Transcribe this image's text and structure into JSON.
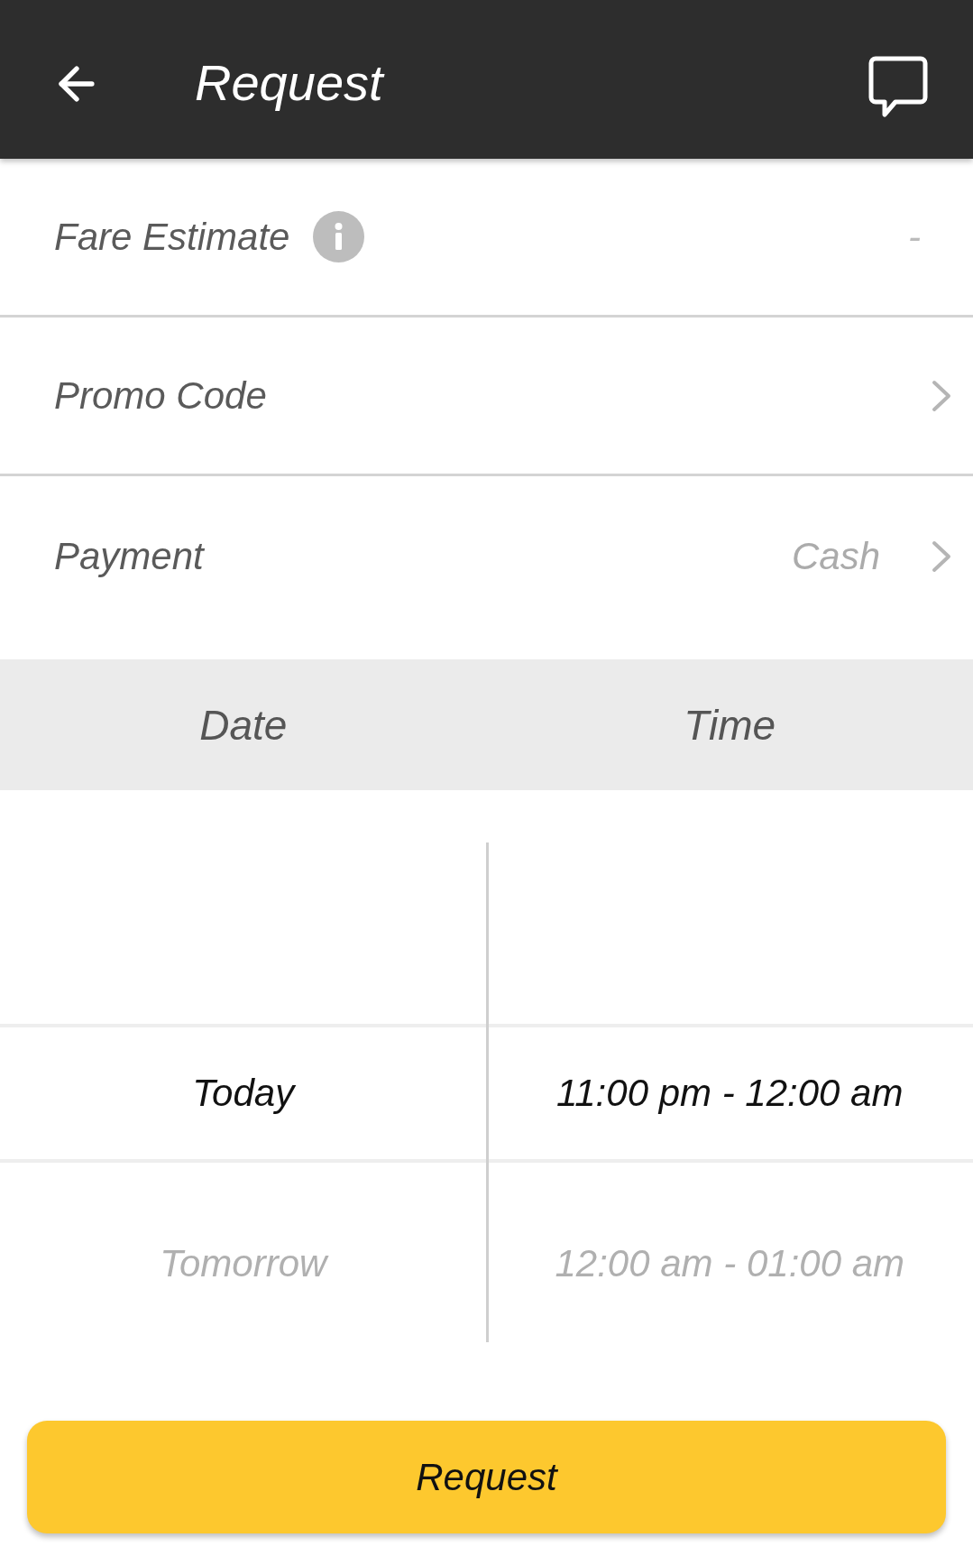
{
  "app_bar": {
    "title": "Request"
  },
  "rows": [
    {
      "kind": "info",
      "label": "Fare Estimate",
      "value": "-"
    },
    {
      "kind": "link",
      "label": "Promo Code"
    },
    {
      "kind": "link",
      "label": "Payment",
      "value": "Cash"
    }
  ],
  "picker": {
    "columns": [
      "Date",
      "Time"
    ],
    "rows": [
      {
        "cells": [
          "Today",
          "11:00 pm - 12:00 am"
        ],
        "selected": true
      },
      {
        "cells": [
          "Tomorrow",
          "12:00 am - 01:00 am"
        ],
        "selected": false
      }
    ]
  },
  "button": {
    "label": "Request"
  }
}
